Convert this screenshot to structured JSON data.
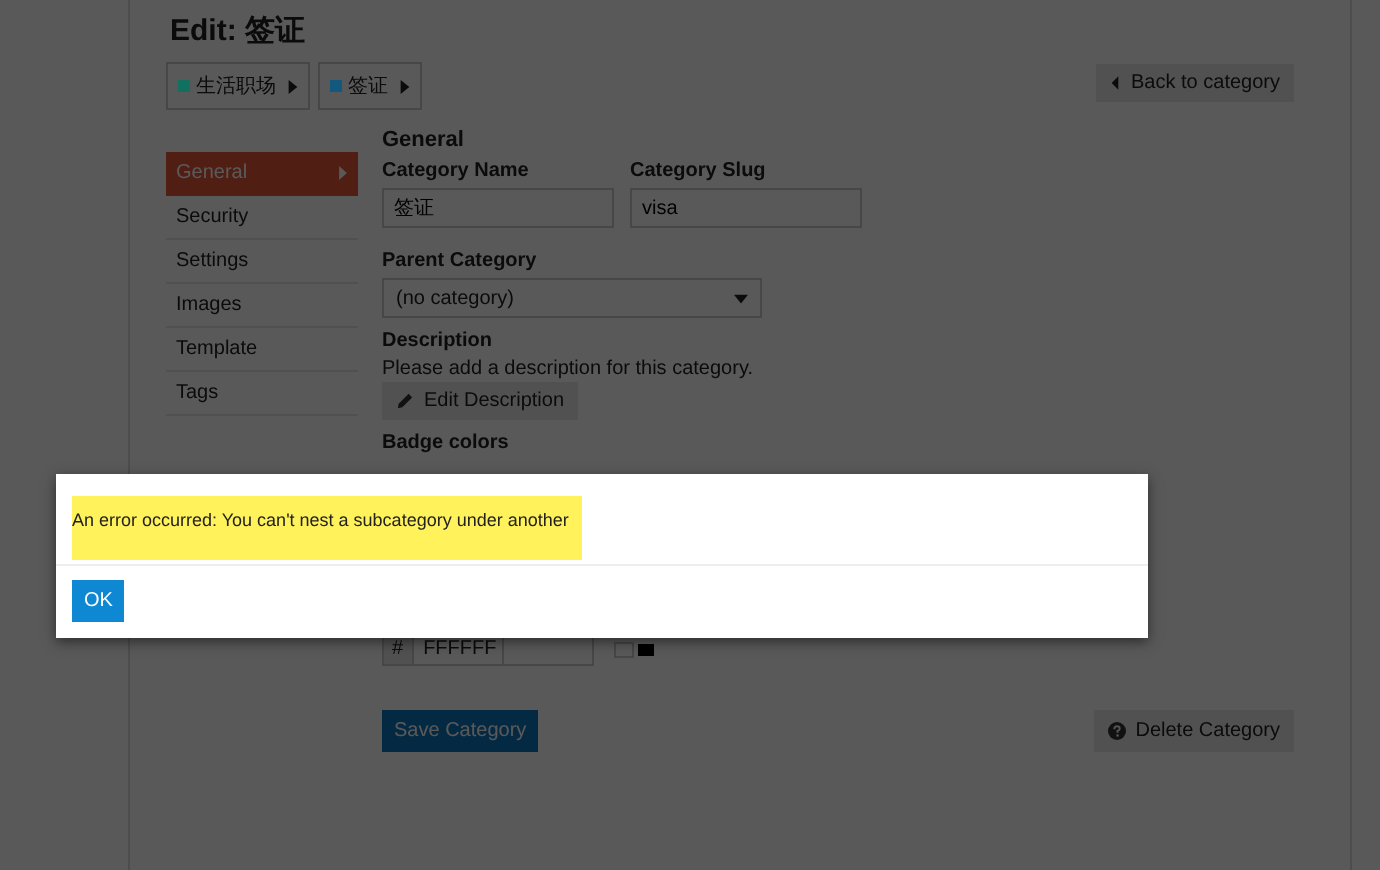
{
  "page": {
    "title": "Edit: 签证",
    "breadcrumbs": [
      {
        "label": "生活职场",
        "color": "#127060"
      },
      {
        "label": "签证",
        "color": "#14587e"
      }
    ],
    "back_button": "Back to category"
  },
  "sidebar": {
    "items": [
      {
        "label": "General",
        "selected": true
      },
      {
        "label": "Security",
        "selected": false
      },
      {
        "label": "Settings",
        "selected": false
      },
      {
        "label": "Images",
        "selected": false
      },
      {
        "label": "Template",
        "selected": false
      },
      {
        "label": "Tags",
        "selected": false
      }
    ]
  },
  "form": {
    "heading": "General",
    "name_label": "Category Name",
    "name_value": "签证",
    "slug_label": "Category Slug",
    "slug_value": "visa",
    "parent_label": "Parent Category",
    "parent_value": "(no category)",
    "description_label": "Description",
    "description_hint": "Please add a description for this category.",
    "edit_description_button": "Edit Description",
    "badge_colors_label": "Badge colors",
    "badge_color": {
      "prefix": "#",
      "value": "FFFFFF"
    },
    "save_button": "Save Category",
    "delete_button": "Delete Category"
  },
  "dialog": {
    "message": "An error occurred: You can't nest a subcategory under another",
    "ok_button": "OK"
  }
}
